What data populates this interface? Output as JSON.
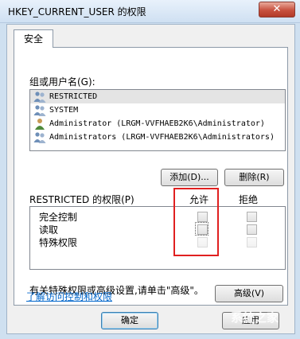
{
  "window": {
    "title": "HKEY_CURRENT_USER 的权限",
    "close_symbol": "✕"
  },
  "tabs": [
    {
      "label": "安全"
    }
  ],
  "security": {
    "group_label": "组或用户名(G):",
    "users": [
      {
        "name": "RESTRICTED",
        "icon": "group-icon",
        "selected": true
      },
      {
        "name": "SYSTEM",
        "icon": "group-icon",
        "selected": false
      },
      {
        "name": "Administrator (LRGM-VVFHAEB2K6\\Administrator)",
        "icon": "user-icon",
        "selected": false
      },
      {
        "name": "Administrators (LRGM-VVFHAEB2K6\\Administrators)",
        "icon": "group-icon",
        "selected": false
      }
    ],
    "add_button": "添加(D)...",
    "remove_button": "删除(R)",
    "permissions_for": "RESTRICTED 的权限(P)",
    "allow_header": "允许",
    "deny_header": "拒绝",
    "permissions": [
      {
        "name": "完全控制",
        "allow": false,
        "deny": false,
        "enabled": true
      },
      {
        "name": "读取",
        "allow": false,
        "deny": false,
        "enabled": true
      },
      {
        "name": "特殊权限",
        "allow": false,
        "deny": false,
        "enabled": false
      }
    ],
    "advanced_text": "有关特殊权限或高级设置,请单击\"高级\"。",
    "advanced_button": "高级(V)",
    "learn_link": "了解访问控制和权限"
  },
  "footer": {
    "ok_button": "确定",
    "apply_button": "应用"
  },
  "watermark": "系统之家",
  "colors": {
    "highlight_box": "#e02020",
    "link": "#0066cc",
    "close_button": "#c7513f"
  }
}
